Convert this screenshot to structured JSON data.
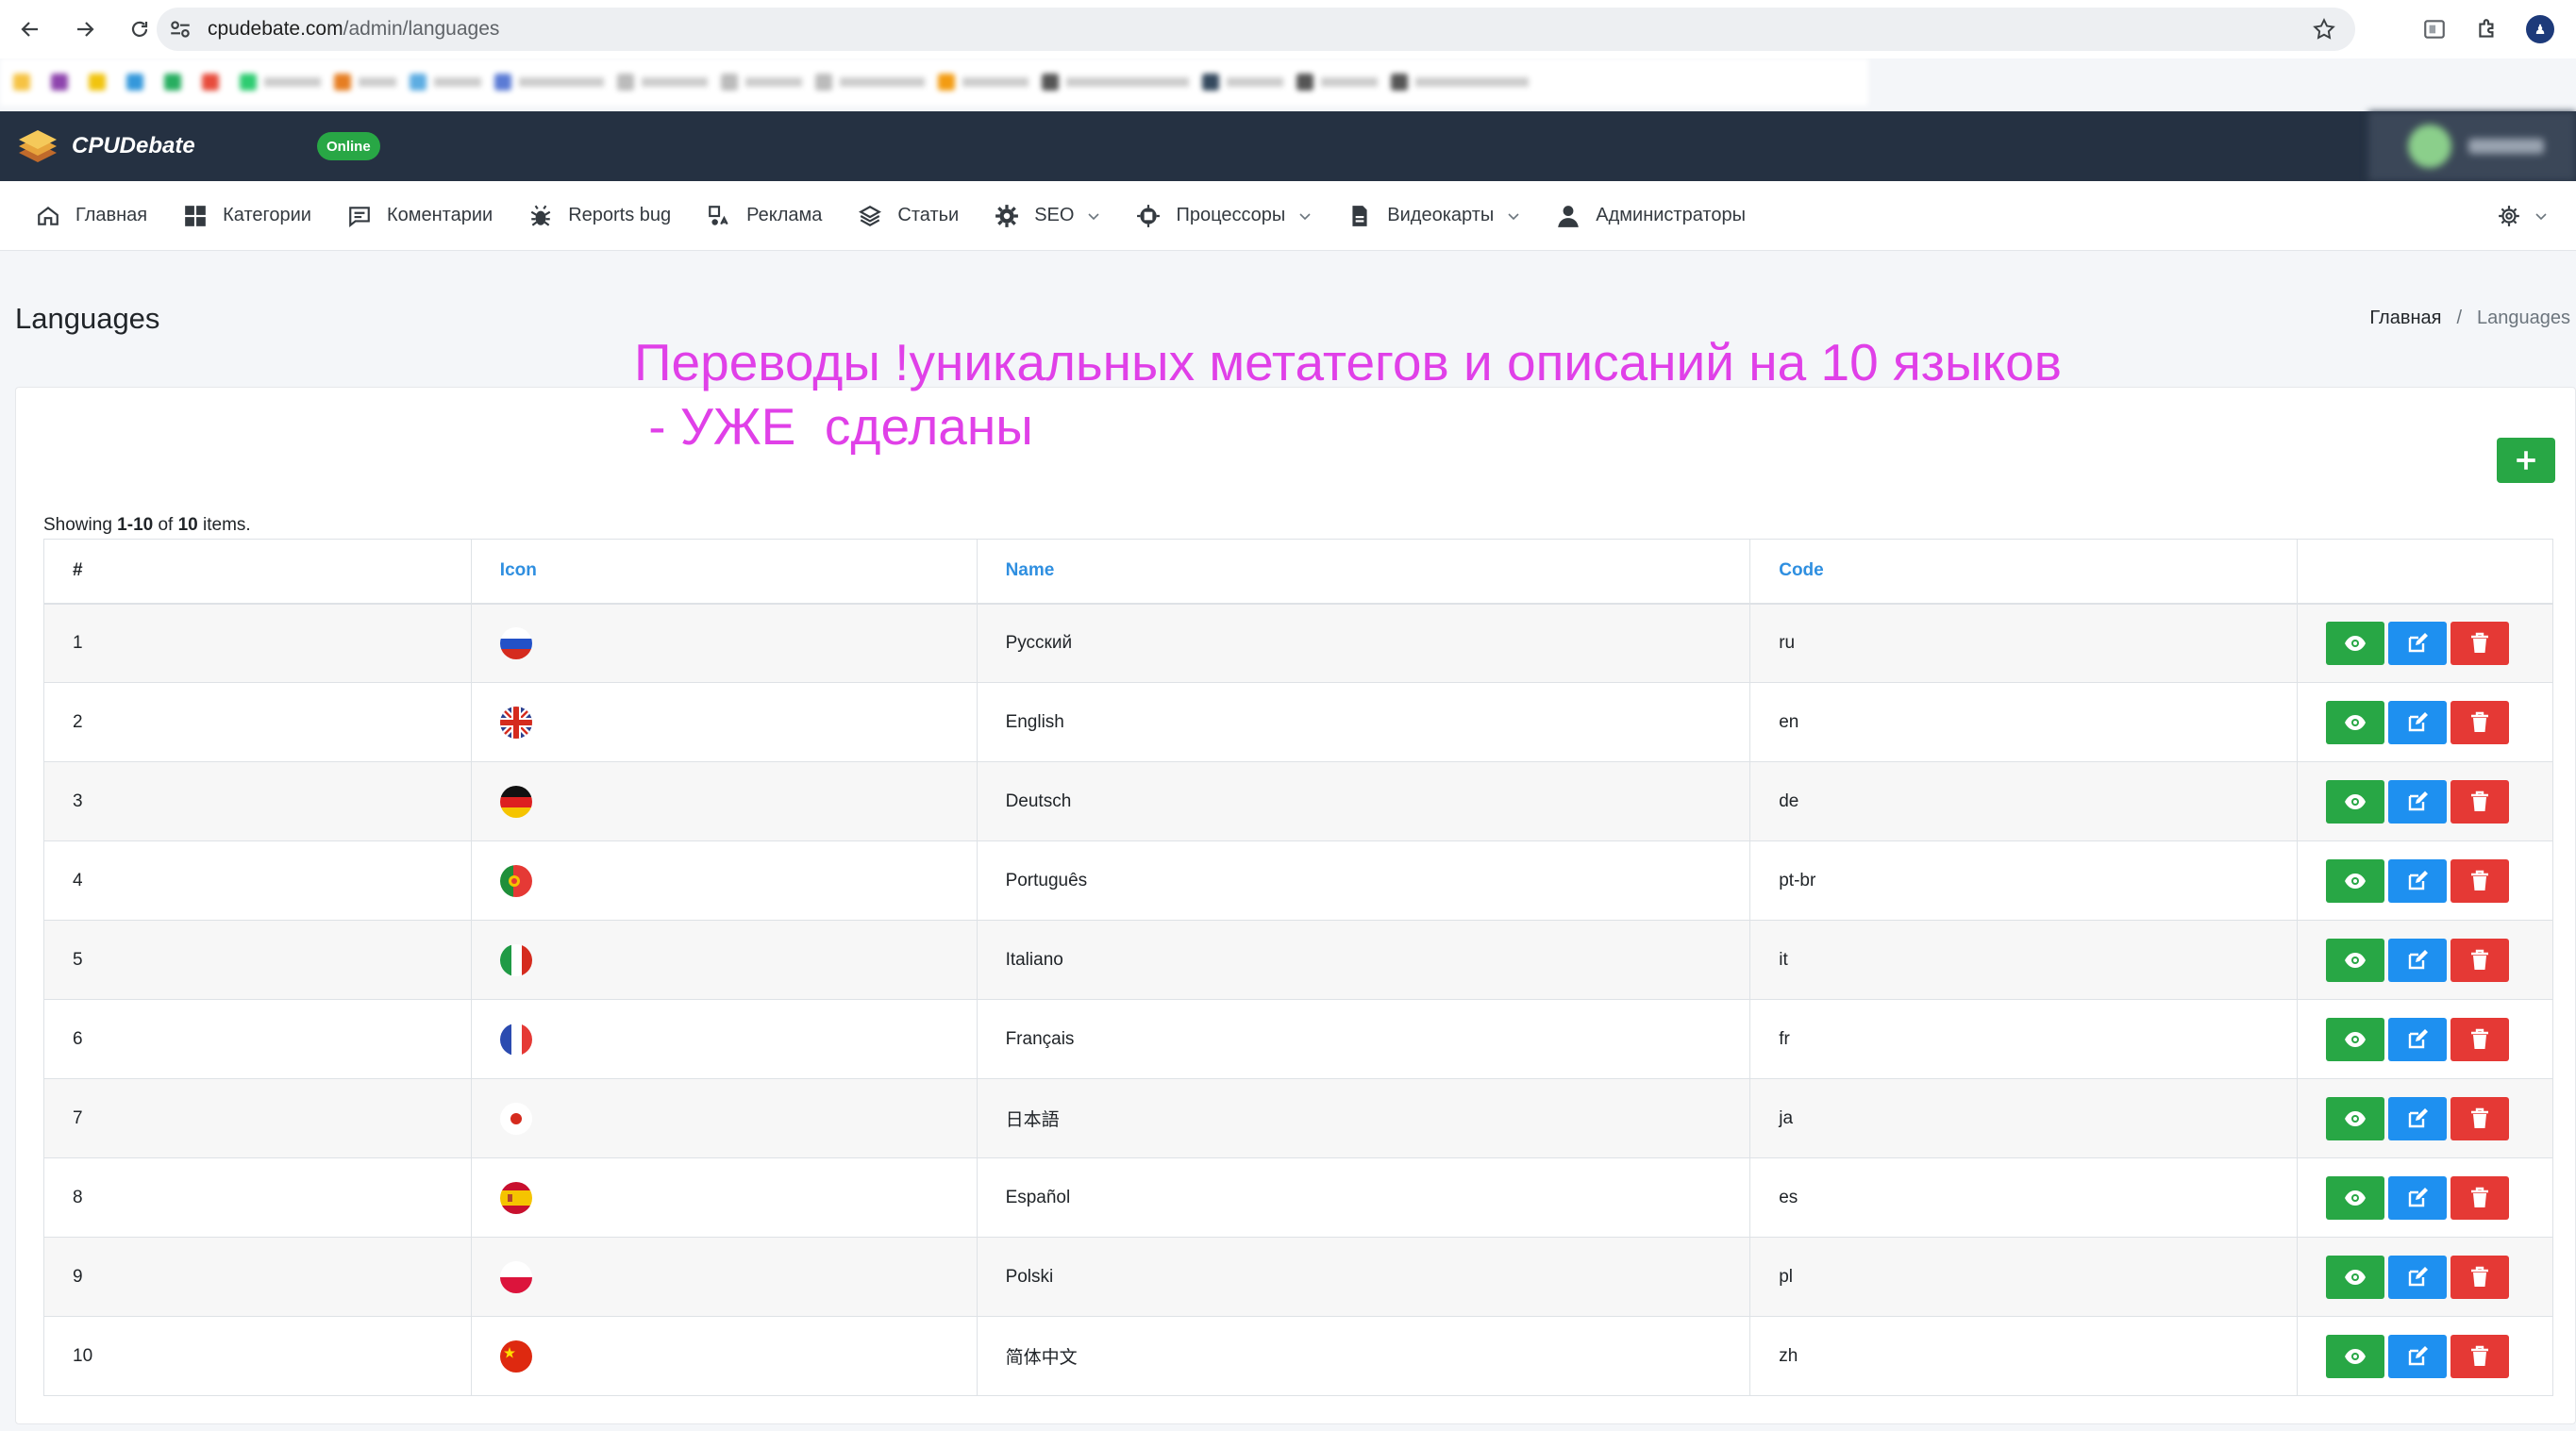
{
  "browser": {
    "url_domain": "cpudebate.com",
    "url_path": "/admin/languages"
  },
  "app": {
    "brand": "CPUDebate",
    "status_badge": "Online"
  },
  "nav": {
    "items": [
      {
        "label": "Главная",
        "icon": "home-icon"
      },
      {
        "label": "Категории",
        "icon": "grid-icon"
      },
      {
        "label": "Коментарии",
        "icon": "comment-icon"
      },
      {
        "label": "Reports bug",
        "icon": "bug-icon"
      },
      {
        "label": "Реклама",
        "icon": "ad-icon"
      },
      {
        "label": "Статьи",
        "icon": "layers-icon"
      },
      {
        "label": "SEO",
        "icon": "gear-icon",
        "dropdown": true
      },
      {
        "label": "Процессоры",
        "icon": "cpu-icon",
        "dropdown": true
      },
      {
        "label": "Видеокарты",
        "icon": "file-icon",
        "dropdown": true
      },
      {
        "label": "Администраторы",
        "icon": "user-icon"
      }
    ]
  },
  "page": {
    "title": "Languages",
    "breadcrumb_home": "Главная",
    "breadcrumb_sep": "/",
    "breadcrumb_current": "Languages",
    "annotation_line1": "Переводы !уникальных метатегов и описаний на 10 языков",
    "annotation_line2": " - УЖЕ  сделаны"
  },
  "summary": {
    "prefix": "Showing ",
    "range": "1-10",
    "of": " of ",
    "total": "10",
    "suffix": " items."
  },
  "table": {
    "headers": {
      "num": "#",
      "icon": "Icon",
      "name": "Name",
      "code": "Code"
    },
    "rows": [
      {
        "num": "1",
        "flag": "ru",
        "name": "Русский",
        "code": "ru"
      },
      {
        "num": "2",
        "flag": "gb",
        "name": "English",
        "code": "en"
      },
      {
        "num": "3",
        "flag": "de",
        "name": "Deutsch",
        "code": "de"
      },
      {
        "num": "4",
        "flag": "pt",
        "name": "Português",
        "code": "pt-br"
      },
      {
        "num": "5",
        "flag": "it",
        "name": "Italiano",
        "code": "it"
      },
      {
        "num": "6",
        "flag": "fr",
        "name": "Français",
        "code": "fr"
      },
      {
        "num": "7",
        "flag": "jp",
        "name": "日本語",
        "code": "ja"
      },
      {
        "num": "8",
        "flag": "es",
        "name": "Español",
        "code": "es"
      },
      {
        "num": "9",
        "flag": "pl",
        "name": "Polski",
        "code": "pl"
      },
      {
        "num": "10",
        "flag": "cn",
        "name": "简体中文",
        "code": "zh"
      }
    ]
  },
  "colors": {
    "header_bg": "#253142",
    "view_button": "#28a745",
    "edit_button": "#1e90f0",
    "delete_button": "#e53935",
    "annotation": "#e040e8",
    "link": "#2f8fe0"
  }
}
